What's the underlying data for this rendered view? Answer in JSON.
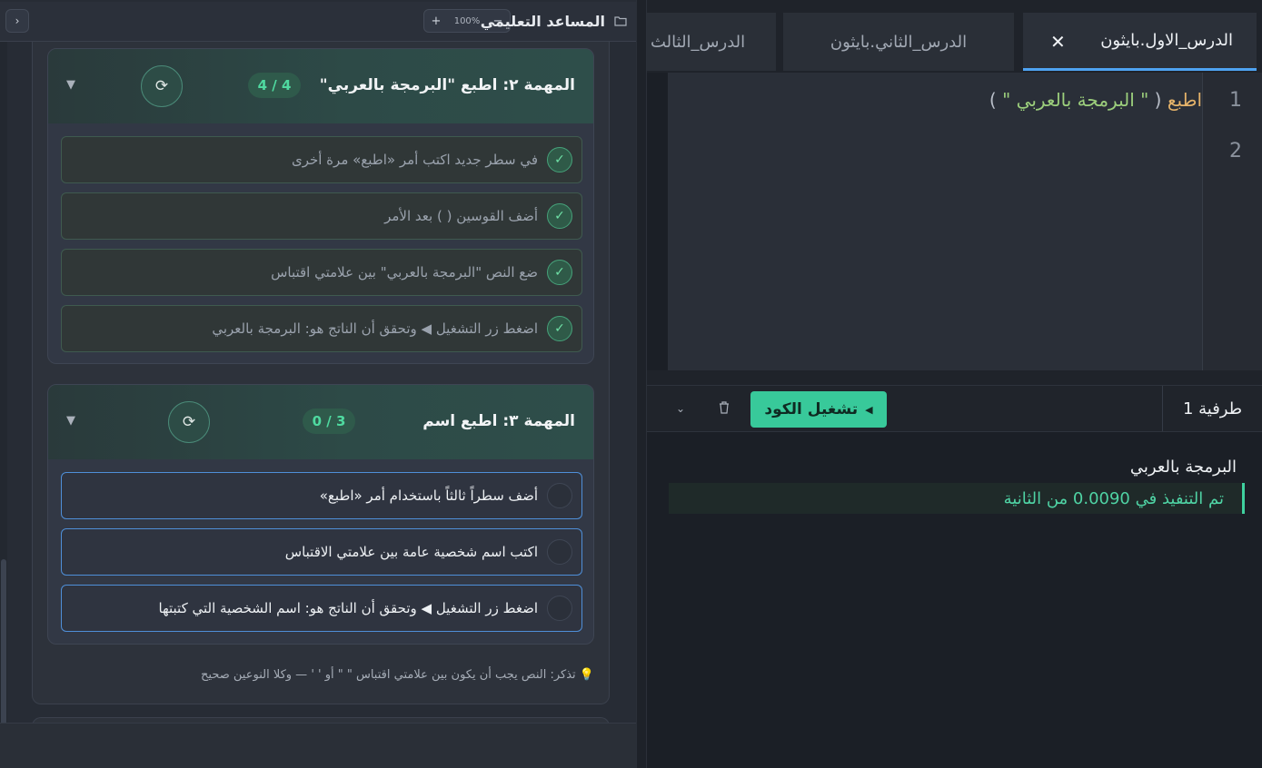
{
  "assistant": {
    "title": "المساعد التعليمي",
    "zoom": "100%",
    "zoom_plus": "+",
    "zoom_minus": "−",
    "collapse": "›"
  },
  "tasks": [
    {
      "title": "المهمة ٢: اطبع \"البرمجة بالعربي\"",
      "progress": "4 / 4",
      "reset": "⟳",
      "toggle": "▼",
      "steps": [
        {
          "text": "في سطر جديد اكتب أمر «اطبع» مرة أخرى",
          "done": true
        },
        {
          "text": "أضف القوسين ( ) بعد الأمر",
          "done": true
        },
        {
          "text": "ضع النص \"البرمجة بالعربي\" بين علامتي اقتباس",
          "done": true
        },
        {
          "text": "اضغط زر التشغيل ◀ وتحقق أن الناتج هو: البرمجة بالعربي",
          "done": true
        }
      ]
    },
    {
      "title": "المهمة ٣: اطبع اسم",
      "progress": "0 / 3",
      "reset": "⟳",
      "toggle": "▼",
      "steps": [
        {
          "text": "أضف سطراً ثالثاً باستخدام أمر «اطبع»",
          "done": false
        },
        {
          "text": "اكتب اسم شخصية عامة بين علامتي الاقتباس",
          "done": false
        },
        {
          "text": "اضغط زر التشغيل ◀ وتحقق أن الناتج هو: اسم الشخصية التي كتبتها",
          "done": false
        }
      ]
    }
  ],
  "tip": "💡 تذكر: النص يجب أن يكون بين علامتي اقتباس \" \" أو ' ' — وكلا النوعين صحيح",
  "check_glyph": "✓",
  "editor": {
    "tabs": [
      {
        "label": "الدرس_الاول.بايثون",
        "active": true,
        "close": "✕"
      },
      {
        "label": "الدرس_الثاني.بايثون",
        "active": false
      },
      {
        "label": "الدرس_الثالث",
        "active": false
      }
    ],
    "line_numbers": [
      "1",
      "2"
    ],
    "code": {
      "keyword": "اطبع",
      "open_paren": "(",
      "string": "\" البرمجة بالعربي \"",
      "close_paren": ")"
    }
  },
  "terminal": {
    "label": "طرفية 1",
    "run_label": "تشغيل الكود",
    "run_icon": "◀",
    "chevron": "⌄",
    "output": "البرمجة بالعربي",
    "status": "تم التنفيذ في 0.0090 من الثانية"
  },
  "colors": {
    "accent": "#38c99a",
    "tab_active_border": "#4ea3f2",
    "keyword": "#e5b36a",
    "string": "#9ccf7c"
  }
}
